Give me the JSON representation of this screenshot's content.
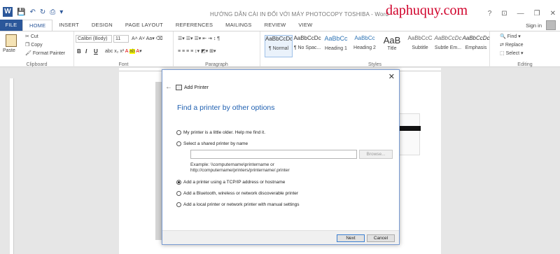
{
  "window": {
    "title": "HƯỚNG DẪN CÀI IN ĐỐI VỚI MÁY PHOTOCOPY TOSHIBA - Word",
    "brand_watermark": "daphuquy.com",
    "controls": [
      "?",
      "⊡",
      "—",
      "❐",
      "✕"
    ]
  },
  "tabs": [
    "FILE",
    "HOME",
    "INSERT",
    "DESIGN",
    "PAGE LAYOUT",
    "REFERENCES",
    "MAILINGS",
    "REVIEW",
    "VIEW"
  ],
  "active_tab": "HOME",
  "signin": "Sign in",
  "ribbon": {
    "clipboard": {
      "label": "Clipboard",
      "paste": "Paste",
      "cut": "Cut",
      "copy": "Copy",
      "format_painter": "Format Painter"
    },
    "font": {
      "label": "Font",
      "name": "Calibri (Body)",
      "size": "11",
      "bold": "B",
      "italic": "I",
      "underline": "U"
    },
    "paragraph": {
      "label": "Paragraph"
    },
    "styles": {
      "label": "Styles",
      "items": [
        {
          "sample": "AaBbCcDc",
          "name": "¶ Normal"
        },
        {
          "sample": "AaBbCcDc",
          "name": "¶ No Spac..."
        },
        {
          "sample": "AaBbCc",
          "name": "Heading 1"
        },
        {
          "sample": "AaBbCc",
          "name": "Heading 2"
        },
        {
          "sample": "AaB",
          "name": "Title"
        },
        {
          "sample": "AaBbCcC",
          "name": "Subtitle"
        },
        {
          "sample": "AaBbCcDc",
          "name": "Subtle Em..."
        },
        {
          "sample": "AaBbCcDc",
          "name": "Emphasis"
        }
      ]
    },
    "editing": {
      "label": "Editing",
      "find": "Find",
      "replace": "Replace",
      "select": "Select"
    }
  },
  "dialog": {
    "title": "Add Printer",
    "heading": "Find a printer by other options",
    "options": [
      "My printer is a little older. Help me find it.",
      "Select a shared printer by name",
      "Add a printer using a TCP/IP address or hostname",
      "Add a Bluetooth, wireless or network discoverable printer",
      "Add a local printer or network printer with manual settings"
    ],
    "selected_option": 2,
    "browse": "Browse...",
    "example_line1": "Example: \\\\computername\\printername or",
    "example_line2": "http://computername/printers/printername/.printer",
    "next": "Next",
    "cancel": "Cancel"
  }
}
